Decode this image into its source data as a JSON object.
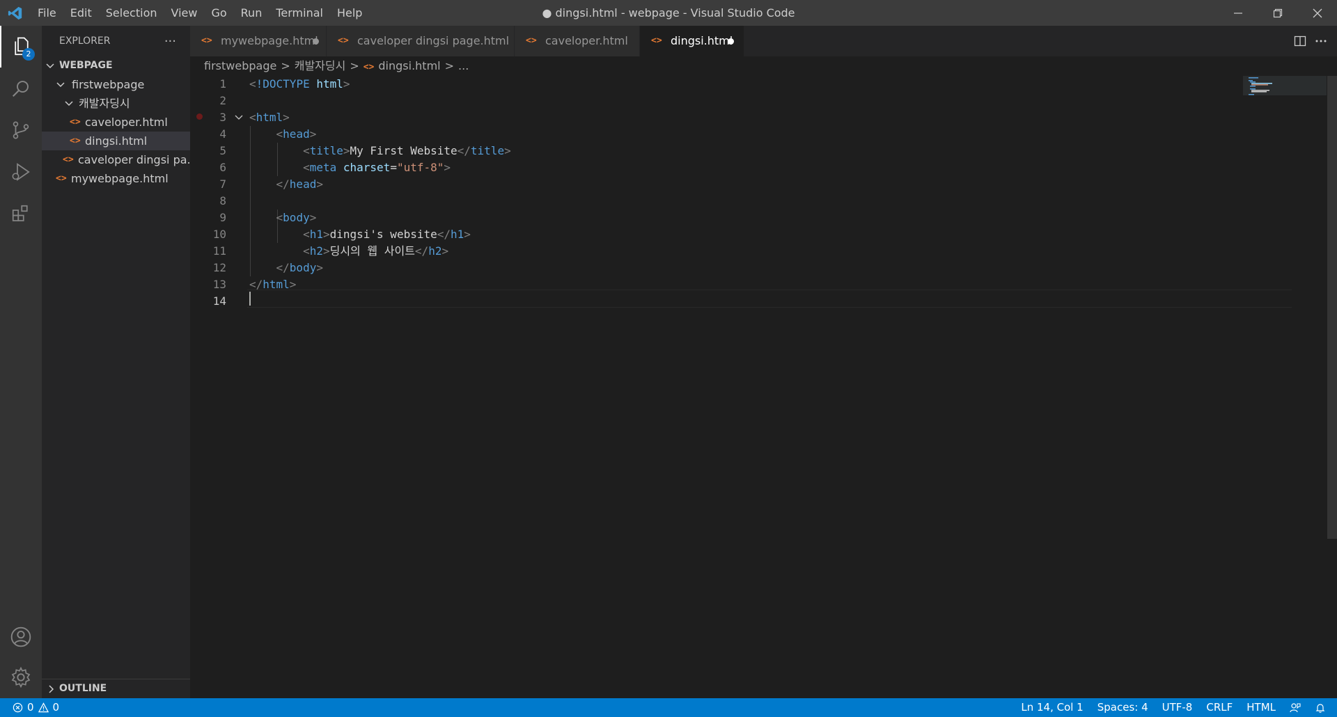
{
  "menu": [
    "File",
    "Edit",
    "Selection",
    "View",
    "Go",
    "Run",
    "Terminal",
    "Help"
  ],
  "window_title": "● dingsi.html - webpage - Visual Studio Code",
  "explorer": {
    "header": "EXPLORER",
    "more": "···",
    "section": "WEBPAGE",
    "tree": [
      {
        "label": "firstwebpage"
      },
      {
        "label": "캐발자딩시"
      },
      {
        "label": "caveloper.html"
      },
      {
        "label": "dingsi.html"
      },
      {
        "label": "caveloper dingsi pa..."
      },
      {
        "label": "mywebpage.html"
      }
    ],
    "outline": "OUTLINE",
    "badge": "2"
  },
  "tabs": [
    {
      "label": "mywebpage.html"
    },
    {
      "label": "caveloper dingsi page.html"
    },
    {
      "label": "caveloper.html"
    },
    {
      "label": "dingsi.html"
    }
  ],
  "file_icon_glyph": "<>",
  "breadcrumb": [
    "firstwebpage",
    "캐발자딩시",
    "dingsi.html",
    "..."
  ],
  "code": {
    "line_numbers": [
      "1",
      "2",
      "3",
      "4",
      "5",
      "6",
      "7",
      "8",
      "9",
      "10",
      "11",
      "12",
      "13",
      "14"
    ],
    "title_text": "My First Website",
    "charset_value": "\"utf-8\"",
    "h1_text": "dingsi's website",
    "h2_text": "딩시의 웹 사이트"
  },
  "status": {
    "errors": "0",
    "warnings": "0",
    "position": "Ln 14, Col 1",
    "spaces": "Spaces: 4",
    "encoding": "UTF-8",
    "eol": "CRLF",
    "language": "HTML"
  },
  "colors": {
    "statusbar": "#007acc",
    "tag": "#569cd6",
    "string": "#ce9178",
    "attribute": "#9cdcfe",
    "file_icon": "#e37933"
  }
}
